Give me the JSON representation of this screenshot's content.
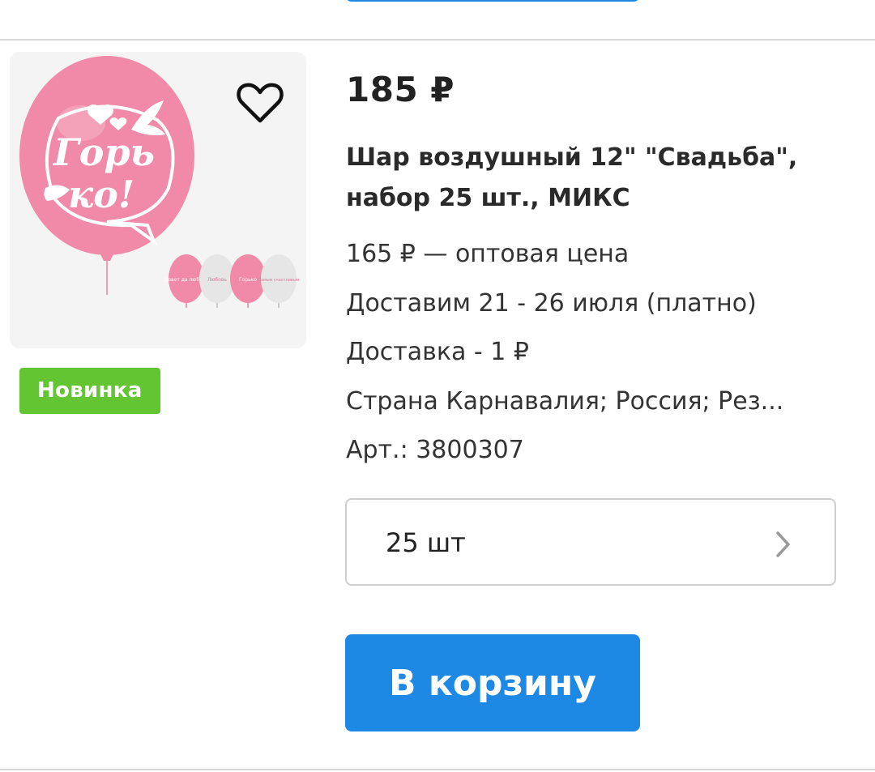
{
  "product": {
    "price": "185 ₽",
    "title": "Шар воздушный 12\" \"Свадьба\", набор 25 шт., МИКС",
    "badge": "Новинка",
    "wholesale_price": "165 ₽ — оптовая цена",
    "delivery_date": "Доставим 21 - 26 июля (платно)",
    "delivery_cost": "Доставка - 1 ₽",
    "country": "Страна Карнавалия; Россия; Рез...",
    "sku": "Арт.: 3800307",
    "image": {
      "main_text_line1": "Горь",
      "main_text_line2": "ко!",
      "thumb_labels": [
        "Совет да любовь",
        "Любовь",
        "Горько",
        "Самым счастливым"
      ]
    }
  },
  "quantity_select": {
    "value": "25 шт"
  },
  "actions": {
    "cart_button_label": "В корзину",
    "favorite_icon": "heart-outline-icon",
    "chevron_icon": "chevron-right-icon"
  },
  "colors": {
    "primary_blue": "#1e88e5",
    "badge_green": "#63c532",
    "balloon_pink": "#f08aa8"
  }
}
